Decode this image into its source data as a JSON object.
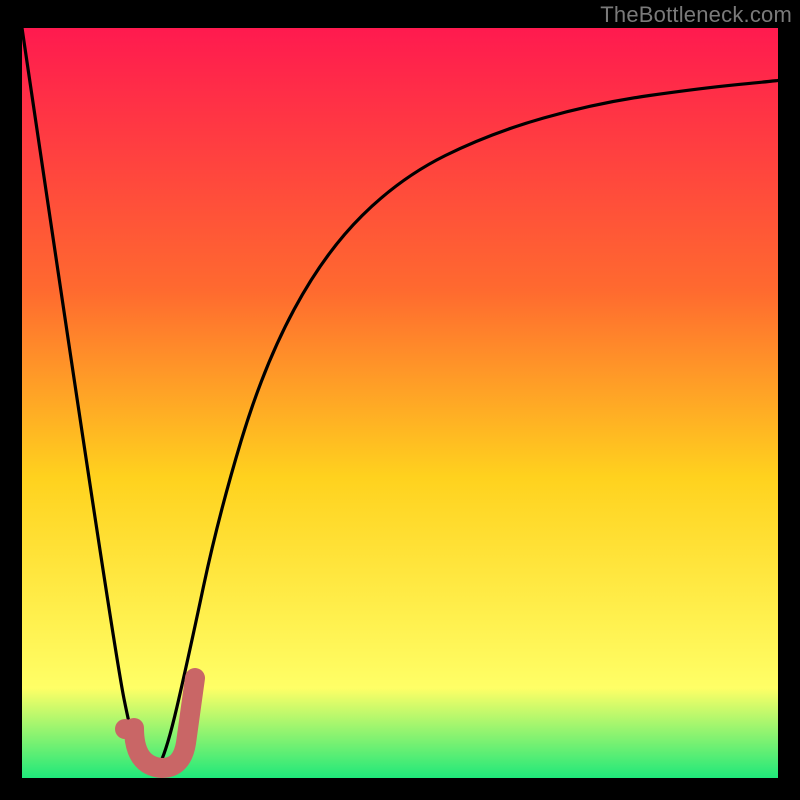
{
  "watermark": "TheBottleneck.com",
  "colors": {
    "gradient_top": "#ff1a4f",
    "gradient_mid1": "#ff6a2f",
    "gradient_mid2": "#ffd21e",
    "gradient_mid3": "#ffff66",
    "gradient_bottom": "#1fe87a",
    "curve": "#000000",
    "marker_stroke": "#c96666",
    "marker_fill": "#c96666"
  },
  "chart_data": {
    "type": "line",
    "title": "",
    "xlabel": "",
    "ylabel": "",
    "xlim": [
      0,
      100
    ],
    "ylim": [
      0,
      100
    ],
    "grid": false,
    "legend": false,
    "series": [
      {
        "name": "bottleneck-curve",
        "x": [
          0,
          12,
          15,
          17,
          19,
          22,
          26,
          32,
          40,
          50,
          62,
          76,
          90,
          100
        ],
        "values": [
          100,
          18,
          3,
          0,
          3,
          16,
          35,
          55,
          70,
          80,
          86,
          90,
          92,
          93
        ]
      }
    ],
    "annotations": [
      {
        "name": "highlight-j-stroke",
        "type": "path",
        "approx_center_x": 18,
        "approx_center_y": 4
      },
      {
        "name": "highlight-dot",
        "type": "point",
        "x": 14.5,
        "y": 5
      }
    ]
  }
}
